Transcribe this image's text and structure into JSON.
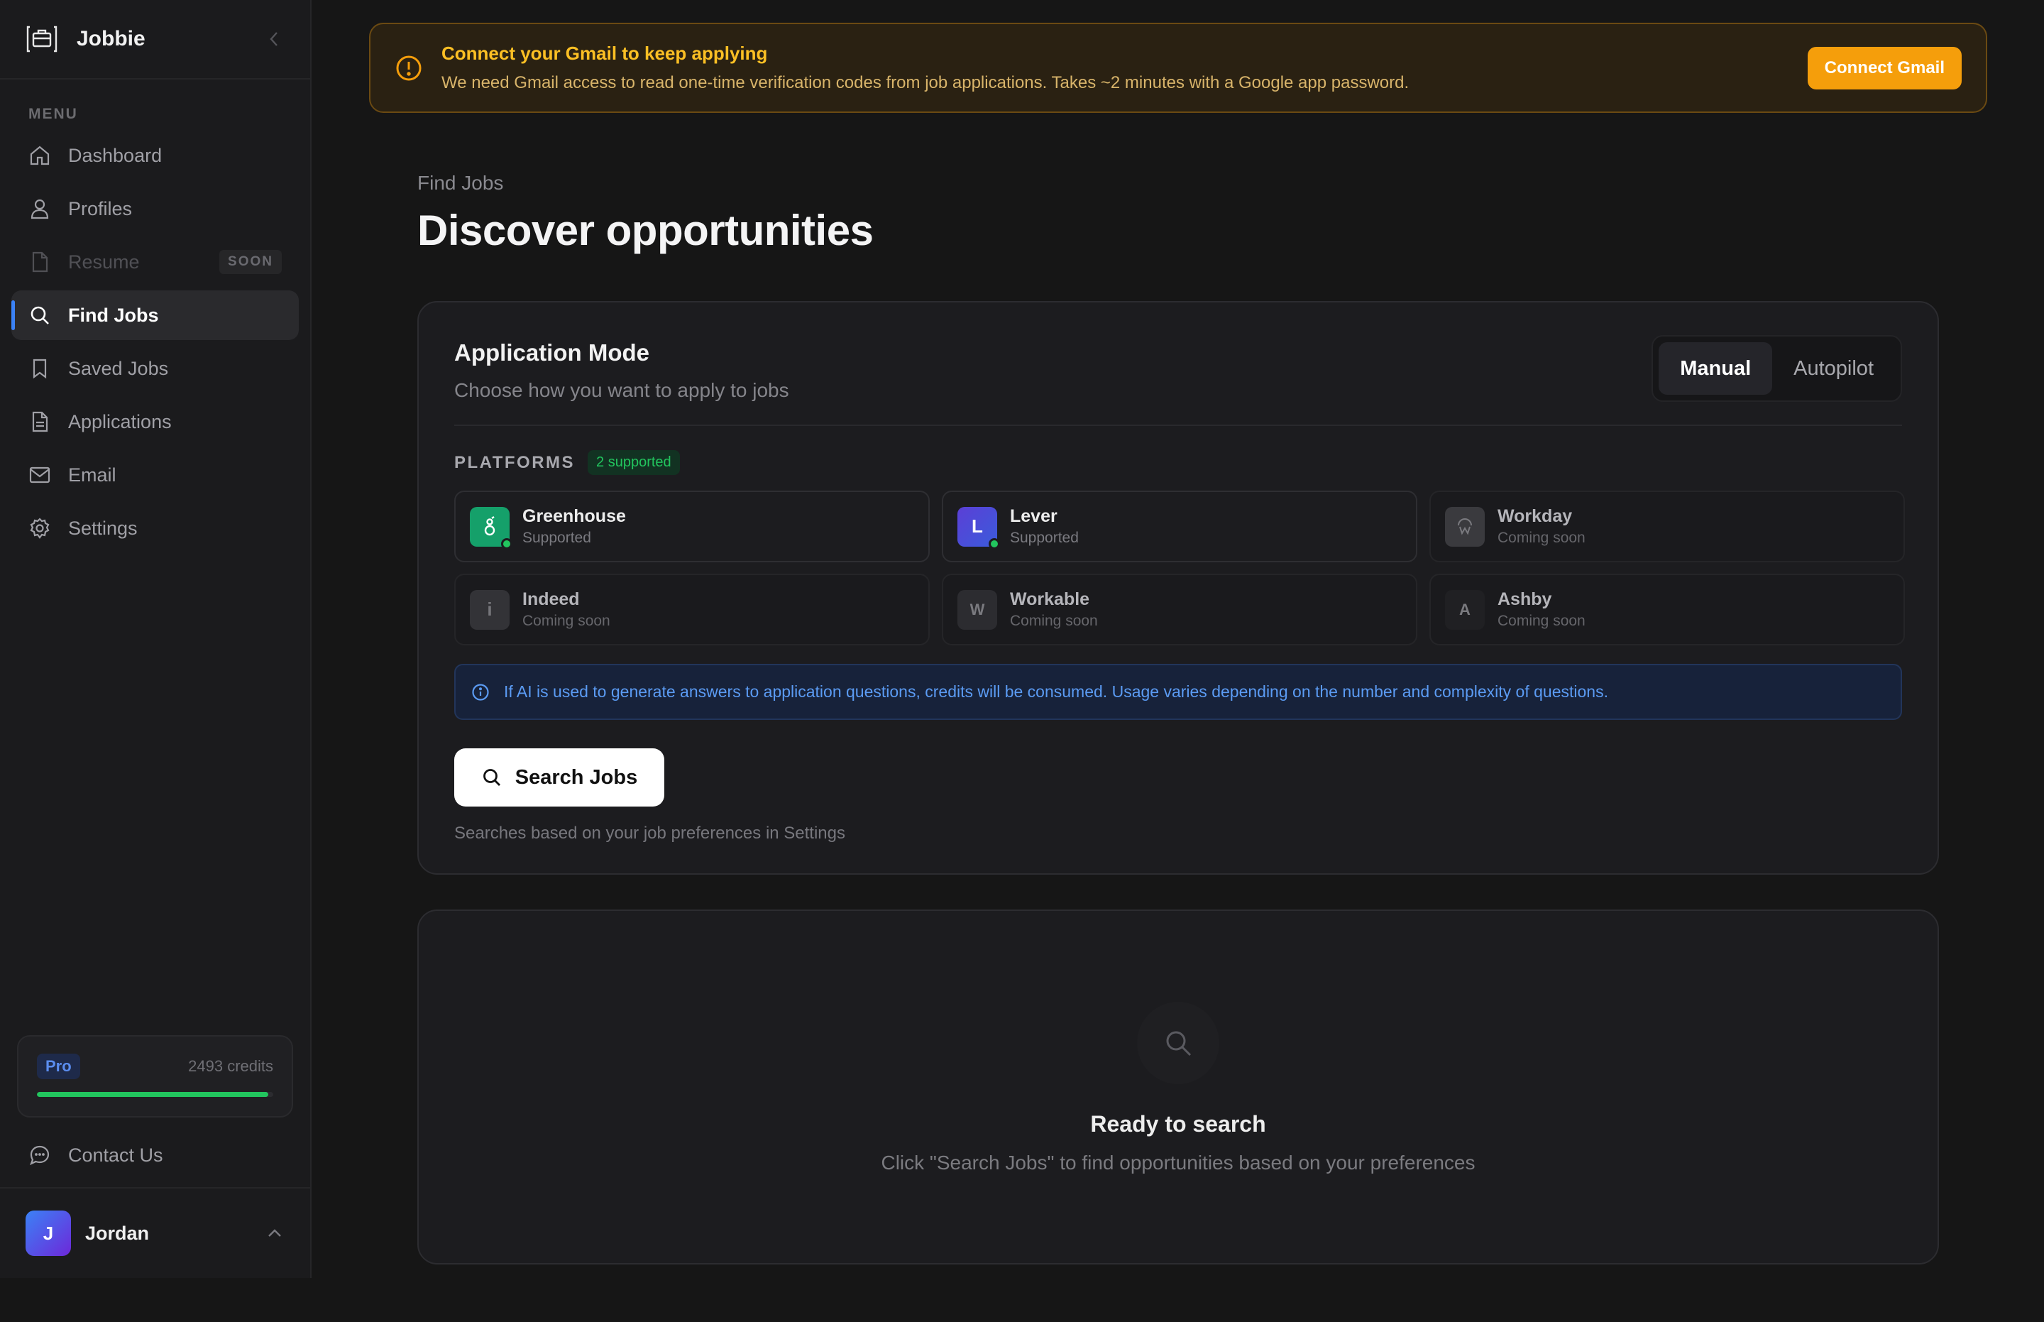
{
  "sidebar": {
    "brand": "Jobbie",
    "menu_label": "MENU",
    "items": [
      {
        "label": "Dashboard"
      },
      {
        "label": "Profiles"
      },
      {
        "label": "Resume",
        "badge": "SOON"
      },
      {
        "label": "Find Jobs"
      },
      {
        "label": "Saved Jobs"
      },
      {
        "label": "Applications"
      },
      {
        "label": "Email"
      },
      {
        "label": "Settings"
      }
    ],
    "plan": {
      "name": "Pro",
      "credits": "2493 credits",
      "usage_fraction": 0.98
    },
    "contact": "Contact Us",
    "user": {
      "initial": "J",
      "name": "Jordan"
    }
  },
  "banner": {
    "title": "Connect your Gmail to keep applying",
    "description": "We need Gmail access to read one-time verification codes from job applications. Takes ~2 minutes with a Google app password.",
    "button": "Connect Gmail"
  },
  "page": {
    "breadcrumb": "Find Jobs",
    "title": "Discover opportunities"
  },
  "mode": {
    "title": "Application Mode",
    "subtitle": "Choose how you want to apply to jobs",
    "options": [
      "Manual",
      "Autopilot"
    ],
    "selected": "Manual"
  },
  "platforms": {
    "label": "PLATFORMS",
    "badge": "2 supported",
    "items": [
      {
        "name": "Greenhouse",
        "status": "Supported",
        "glyph": "g",
        "color": "#15a06a"
      },
      {
        "name": "Lever",
        "status": "Supported",
        "glyph": "L",
        "color": "#5b3fd6"
      },
      {
        "name": "Workday",
        "status": "Coming soon",
        "glyph": "w",
        "color": "#3a3a3e"
      },
      {
        "name": "Indeed",
        "status": "Coming soon",
        "glyph": "i",
        "color": "#333337"
      },
      {
        "name": "Workable",
        "status": "Coming soon",
        "glyph": "W",
        "color": "#2c2c30"
      },
      {
        "name": "Ashby",
        "status": "Coming soon",
        "glyph": "A",
        "color": "#202023"
      }
    ]
  },
  "info": "If AI is used to generate answers to application questions, credits will be consumed. Usage varies depending on the number and complexity of questions.",
  "search": {
    "button": "Search Jobs",
    "hint": "Searches based on your job preferences in Settings"
  },
  "empty": {
    "title": "Ready to search",
    "subtitle": "Click \"Search Jobs\" to find opportunities based on your preferences"
  }
}
